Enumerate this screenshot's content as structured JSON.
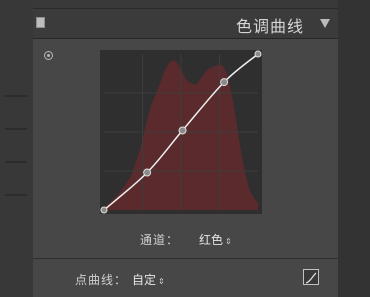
{
  "panel": {
    "title": "色调曲线"
  },
  "curve": {
    "control_points": [
      {
        "input": 0,
        "output": 0
      },
      {
        "input": 0.28,
        "output": 0.24
      },
      {
        "input": 0.51,
        "output": 0.51
      },
      {
        "input": 0.78,
        "output": 0.82
      },
      {
        "input": 1,
        "output": 1
      }
    ],
    "histogram": [
      0.02,
      0.03,
      0.05,
      0.07,
      0.09,
      0.11,
      0.14,
      0.17,
      0.2,
      0.24,
      0.3,
      0.36,
      0.43,
      0.52,
      0.6,
      0.67,
      0.72,
      0.77,
      0.82,
      0.88,
      0.92,
      0.95,
      0.96,
      0.95,
      0.92,
      0.88,
      0.84,
      0.82,
      0.81,
      0.8,
      0.82,
      0.85,
      0.88,
      0.9,
      0.91,
      0.92,
      0.93,
      0.93,
      0.92,
      0.88,
      0.8,
      0.7,
      0.58,
      0.45,
      0.33,
      0.23,
      0.15,
      0.1,
      0.07,
      0.05
    ],
    "colors": {
      "background": "#2f2f2f",
      "histogram": "#5a2a2c",
      "line": "#f0f0f0",
      "grid": "#3d3d3d"
    }
  },
  "channel": {
    "label": "通道：",
    "value": "红色"
  },
  "point_curve": {
    "label": "点曲线：",
    "value": "自定"
  },
  "icons": {
    "target": "target-adjustment-icon",
    "collapse": "collapse-toggle-icon",
    "arrow": "panel-collapse-arrow-icon",
    "edit": "edit-point-curve-icon",
    "stepper": "up-down-arrows-icon"
  }
}
